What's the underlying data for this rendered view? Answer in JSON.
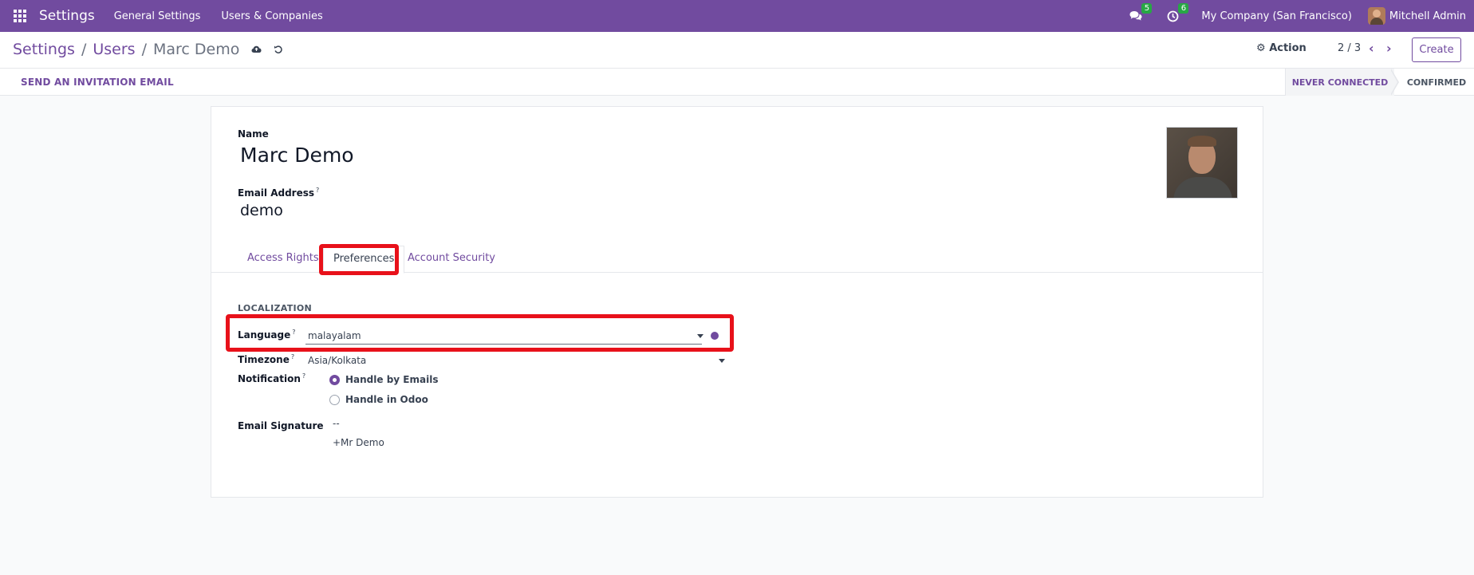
{
  "navbar": {
    "app_name": "Settings",
    "menus": [
      "General Settings",
      "Users & Companies"
    ],
    "messages_count": "5",
    "activities_count": "6",
    "company": "My Company (San Francisco)",
    "user": "Mitchell Admin"
  },
  "control": {
    "breadcrumb": [
      "Settings",
      "Users",
      "Marc Demo"
    ],
    "action_label": "Action",
    "pager": "2 / 3",
    "create_label": "Create"
  },
  "statusbar": {
    "invite_label": "SEND AN INVITATION EMAIL",
    "stages": [
      "NEVER CONNECTED",
      "CONFIRMED"
    ]
  },
  "form": {
    "name_label": "Name",
    "name_value": "Marc Demo",
    "email_label": "Email Address",
    "email_value": "demo",
    "tabs": [
      "Access Rights",
      "Preferences",
      "Account Security"
    ],
    "section_title": "LOCALIZATION",
    "language_label": "Language",
    "language_value": "malayalam",
    "timezone_label": "Timezone",
    "timezone_value": "Asia/Kolkata",
    "notification_label": "Notification",
    "notification_options": [
      "Handle by Emails",
      "Handle in Odoo"
    ],
    "notification_selected": "Handle by Emails",
    "signature_label": "Email Signature",
    "signature_lines": [
      "--",
      "+Mr Demo"
    ],
    "help_mark": "?"
  },
  "colors": {
    "brand": "#714b9f",
    "highlight": "#e8111a",
    "badge": "#28a745"
  }
}
